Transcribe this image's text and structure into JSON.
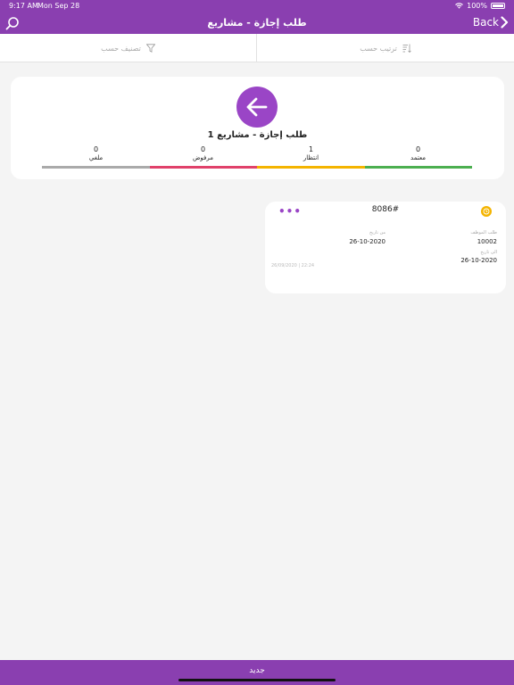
{
  "status_bar": {
    "time": "9:17 AM",
    "date": "Mon Sep 28",
    "battery": "100%"
  },
  "navbar": {
    "title": "طلب إجازة - مشاريع",
    "back_label": "Back"
  },
  "toolbar": {
    "sort_label": "ترتيب حسب",
    "filter_label": "تصنيف حسب"
  },
  "summary": {
    "title": "1 طلب إجازة - مشاريع",
    "stats": [
      {
        "label": "معتمد",
        "count": "0",
        "color": "#4caf50"
      },
      {
        "label": "انتظار",
        "count": "1",
        "color": "#f4b400"
      },
      {
        "label": "مرفوض",
        "count": "0",
        "color": "#e0416a"
      },
      {
        "label": "ملغي",
        "count": "0",
        "color": "#aaaaaa"
      }
    ]
  },
  "request_card": {
    "number": "8086#",
    "employee_label": "طلب الموظف",
    "employee_id": "10002",
    "from_label": "من تاريخ",
    "from_date": "26-10-2020",
    "to_label": "الى تاريخ",
    "to_date": "26-10-2020",
    "created_at": "26/09/2020 | 22:24",
    "status_color": "#f4b400"
  },
  "bottom_bar": {
    "new_label": "جديد"
  },
  "colors": {
    "primary": "#8a3fb0",
    "accent": "#9a45c6"
  }
}
